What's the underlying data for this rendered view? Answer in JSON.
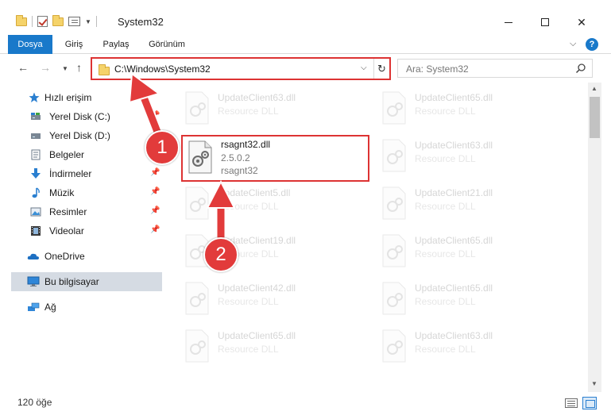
{
  "window": {
    "title": "System32"
  },
  "ribbon": {
    "tabs": [
      {
        "label": "Dosya"
      },
      {
        "label": "Giriş"
      },
      {
        "label": "Paylaş"
      },
      {
        "label": "Görünüm"
      }
    ],
    "help_label": "?"
  },
  "address": {
    "path": "C:\\Windows\\System32"
  },
  "search": {
    "placeholder": "Ara: System32"
  },
  "sidebar": {
    "items": [
      {
        "label": "Hızlı erişim",
        "icon": "star-icon"
      },
      {
        "label": "Yerel Disk (C:)",
        "icon": "drive-icon",
        "pinned": true
      },
      {
        "label": "Yerel Disk (D:)",
        "icon": "drive-icon",
        "pinned": true
      },
      {
        "label": "Belgeler",
        "icon": "documents-icon",
        "pinned": true
      },
      {
        "label": "İndirmeler",
        "icon": "download-icon",
        "pinned": true
      },
      {
        "label": "Müzik",
        "icon": "music-icon",
        "pinned": true
      },
      {
        "label": "Resimler",
        "icon": "pictures-icon",
        "pinned": true
      },
      {
        "label": "Videolar",
        "icon": "video-icon",
        "pinned": true
      },
      {
        "label": "OneDrive",
        "icon": "cloud-icon"
      },
      {
        "label": "Bu bilgisayar",
        "icon": "computer-icon",
        "selected": true
      },
      {
        "label": "Ağ",
        "icon": "network-icon"
      }
    ]
  },
  "files": {
    "highlighted": {
      "name": "rsagnt32.dll",
      "version": "2.5.0.2",
      "description": "rsagnt32"
    },
    "left_column": [
      {
        "name": "UpdateClient63.dll",
        "type": "Resource DLL"
      },
      {
        "name": "UpdateClient5.dll",
        "type": "Resource DLL"
      },
      {
        "name": "UpdateClient19.dll",
        "type": "Resource DLL"
      },
      {
        "name": "UpdateClient42.dll",
        "type": "Resource DLL"
      },
      {
        "name": "UpdateClient65.dll",
        "type": "Resource DLL"
      }
    ],
    "right_column": [
      {
        "name": "UpdateClient65.dll",
        "type": "Resource DLL"
      },
      {
        "name": "UpdateClient63.dll",
        "type": "Resource DLL"
      },
      {
        "name": "UpdateClient21.dll",
        "type": "Resource DLL"
      },
      {
        "name": "UpdateClient65.dll",
        "type": "Resource DLL"
      },
      {
        "name": "UpdateClient65.dll",
        "type": "Resource DLL"
      },
      {
        "name": "UpdateClient63.dll",
        "type": "Resource DLL"
      }
    ]
  },
  "status": {
    "item_count": "120 öğe"
  },
  "annotations": {
    "step1": "1",
    "step2": "2"
  },
  "colors": {
    "accent": "#1979ca",
    "highlight": "#dd3333",
    "selection": "#d5dbe3"
  }
}
